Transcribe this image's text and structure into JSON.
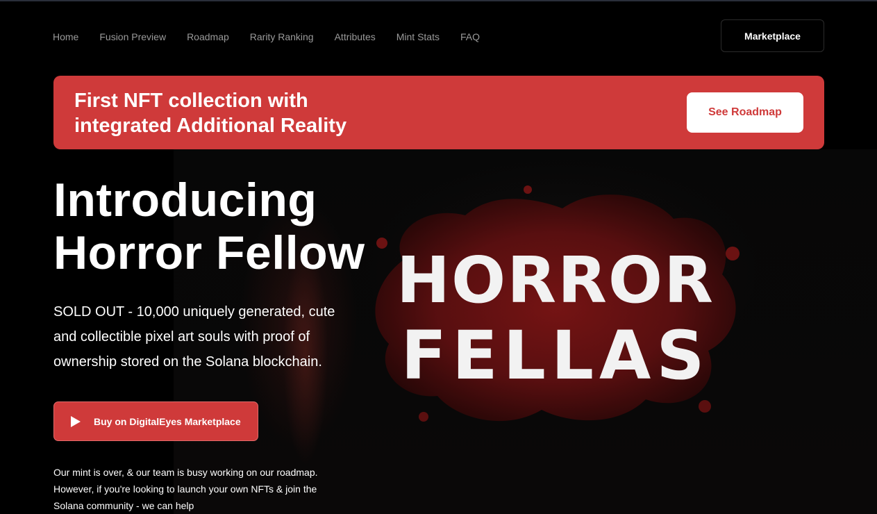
{
  "nav": {
    "items": [
      "Home",
      "Fusion Preview",
      "Roadmap",
      "Rarity Ranking",
      "Attributes",
      "Mint Stats",
      "FAQ"
    ],
    "marketplace_label": "Marketplace"
  },
  "banner": {
    "title_line1": "First NFT collection with",
    "title_line2": "integrated Additional Reality",
    "button_label": "See Roadmap"
  },
  "hero": {
    "title_line1": "Introducing",
    "title_line2": "Horror Fellow",
    "description_line1": "SOLD OUT - 10,000 uniquely generated, cute",
    "description_line2": "and collectible pixel art souls with proof of",
    "description_line3": "ownership stored on the Solana blockchain.",
    "buy_button_label": "Buy on DigitalEyes Marketplace",
    "buy_button_icon": "play-icon",
    "logo_text_line1": "HORROR",
    "logo_text_line2": "FELLAS",
    "note_line1": "Our mint is over, & our team is busy working on our roadmap.",
    "note_line2": "However, if you're looking to launch your own NFTs & join the",
    "note_line3": "Solana community - we can help"
  },
  "colors": {
    "accent": "#cf3a3a",
    "background": "#000000",
    "nav_text": "#9a9a9a"
  }
}
